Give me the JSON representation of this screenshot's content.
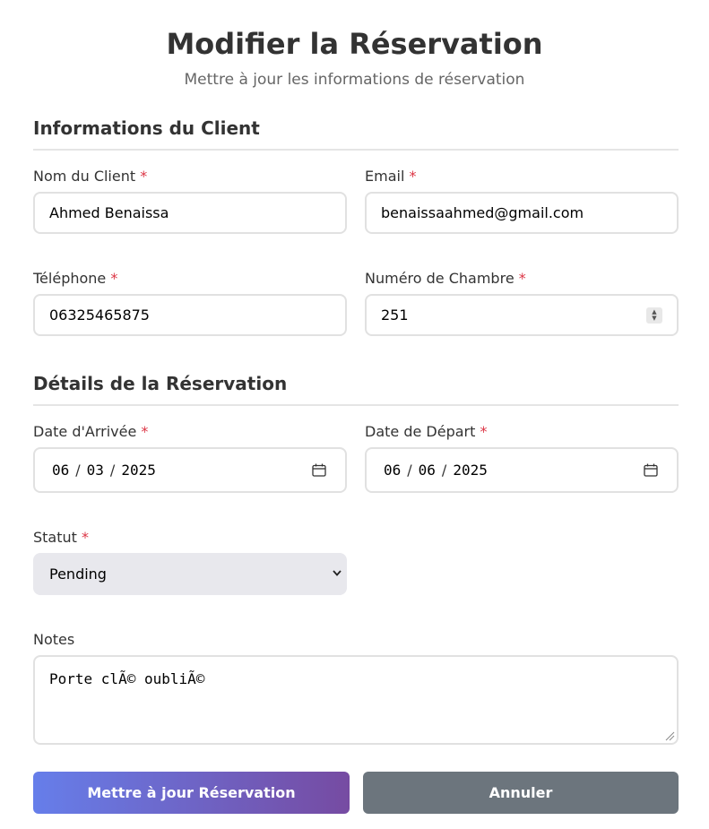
{
  "header": {
    "title": "Modifier la Réservation",
    "subtitle": "Mettre à jour les informations de réservation"
  },
  "sections": {
    "client": "Informations du Client",
    "reservation": "Détails de la Réservation"
  },
  "required_marker": "*",
  "fields": {
    "client_name": {
      "label": "Nom du Client",
      "value": "Ahmed Benaissa"
    },
    "email": {
      "label": "Email",
      "value": "benaissaahmed@gmail.com"
    },
    "phone": {
      "label": "Téléphone",
      "value": "06325465875"
    },
    "room_number": {
      "label": "Numéro de Chambre",
      "value": "251"
    },
    "arrival_date": {
      "label": "Date d'Arrivée",
      "day": "06",
      "month": "03",
      "year": "2025"
    },
    "departure_date": {
      "label": "Date de Départ",
      "day": "06",
      "month": "06",
      "year": "2025"
    },
    "status": {
      "label": "Statut",
      "value": "Pending"
    },
    "notes": {
      "label": "Notes",
      "value": "Porte clÃ© oubliÃ©"
    }
  },
  "actions": {
    "submit_label": "Mettre à jour Réservation",
    "cancel_label": "Annuler"
  },
  "colors": {
    "gradient_start": "#667eea",
    "gradient_end": "#764ba2",
    "cancel": "#6c757d",
    "required": "#dc3545"
  },
  "icons": [
    "calendar-icon",
    "chevron-down-icon",
    "spinner-arrows-icon",
    "resize-grip-icon"
  ]
}
